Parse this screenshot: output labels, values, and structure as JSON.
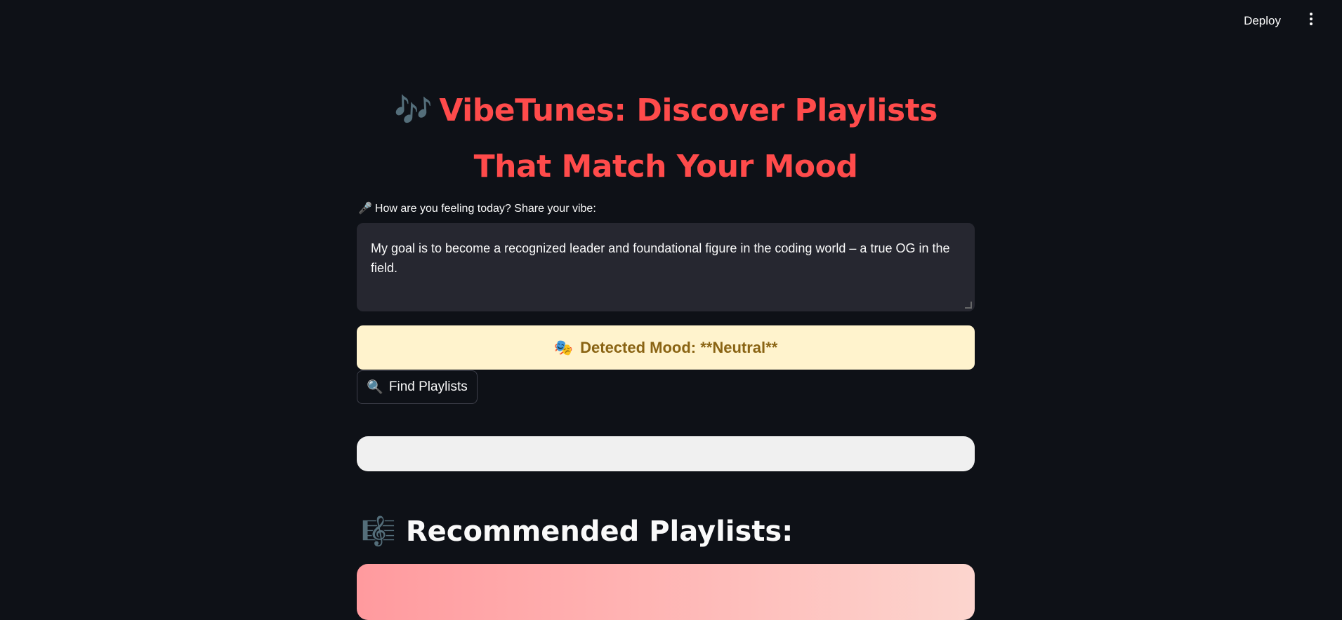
{
  "header": {
    "deploy_label": "Deploy",
    "menu_icon": "kebab-menu-icon"
  },
  "app": {
    "title_emoji": "🎶",
    "title": "VibeTunes: Discover Playlists That Match Your Mood",
    "input_label_emoji": "🎤",
    "input_label": "How are you feeling today? Share your vibe:",
    "input_value": "My goal is to become a recognized leader and foundational figure in the coding world – a true OG in the field.",
    "mood_emoji": "🎭",
    "mood_text": "Detected Mood: **Neutral**",
    "mood_color": "#fff3cd",
    "find_button_emoji": "🔍",
    "find_button_label": "Find Playlists",
    "recommended_emoji": "🎼",
    "recommended_title": "Recommended Playlists:"
  },
  "colors": {
    "background": "#0e1117",
    "accent": "#ff4b4b",
    "input_bg": "#262730"
  }
}
